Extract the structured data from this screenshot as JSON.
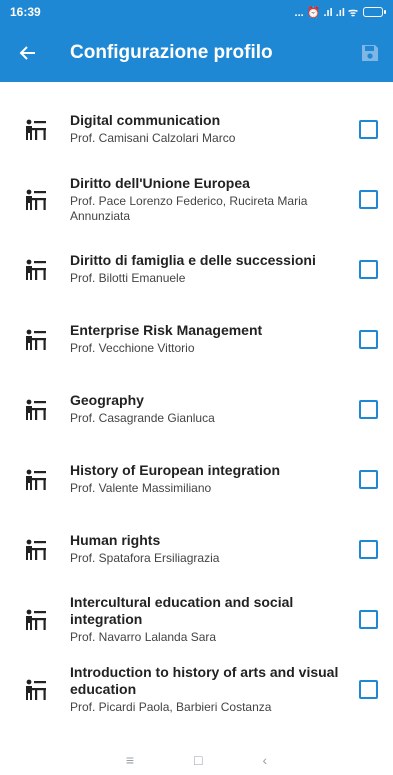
{
  "status": {
    "time": "16:39",
    "icons": "... ⏰ .ıl .ıl ᯤ"
  },
  "toolbar": {
    "title": "Configurazione profilo",
    "back_icon": "arrow-left-icon",
    "save_icon": "save-icon"
  },
  "courses": [
    {
      "title": "Digital communication",
      "prof": "Prof. Camisani Calzolari Marco",
      "checked": false
    },
    {
      "title": "Diritto dell'Unione Europea",
      "prof": "Prof. Pace Lorenzo Federico, Rucireta Maria Annunziata",
      "checked": false
    },
    {
      "title": "Diritto di famiglia e delle successioni",
      "prof": "Prof. Bilotti Emanuele",
      "checked": false
    },
    {
      "title": "Enterprise Risk Management",
      "prof": "Prof. Vecchione Vittorio",
      "checked": false
    },
    {
      "title": "Geography",
      "prof": "Prof. Casagrande Gianluca",
      "checked": false
    },
    {
      "title": "History of European integration",
      "prof": "Prof. Valente Massimiliano",
      "checked": false
    },
    {
      "title": "Human rights",
      "prof": "Prof. Spatafora Ersiliagrazia",
      "checked": false
    },
    {
      "title": "Intercultural education and social integration",
      "prof": "Prof. Navarro Lalanda Sara",
      "checked": false
    },
    {
      "title": "Introduction to history of arts and visual education",
      "prof": "Prof. Picardi Paola, Barbieri Costanza",
      "checked": false
    }
  ],
  "navbar": {
    "menu": "≡",
    "home": "□",
    "back": "‹"
  },
  "colors": {
    "accent": "#1e88d4"
  }
}
